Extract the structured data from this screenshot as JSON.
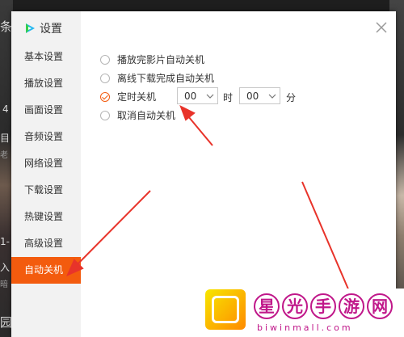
{
  "dialog": {
    "title": "设置",
    "close_icon": "close-icon",
    "accent_color": "#f35b0e"
  },
  "nav": [
    {
      "label": "基本设置",
      "active": false
    },
    {
      "label": "播放设置",
      "active": false
    },
    {
      "label": "画面设置",
      "active": false
    },
    {
      "label": "音频设置",
      "active": false
    },
    {
      "label": "网络设置",
      "active": false
    },
    {
      "label": "下载设置",
      "active": false
    },
    {
      "label": "热键设置",
      "active": false
    },
    {
      "label": "高级设置",
      "active": false
    },
    {
      "label": "自动关机",
      "active": true
    }
  ],
  "options": [
    {
      "label": "播放完影片自动关机",
      "selected": false
    },
    {
      "label": "离线下载完成自动关机",
      "selected": false
    },
    {
      "label": "定时关机",
      "selected": true
    },
    {
      "label": "取消自动关机",
      "selected": false
    }
  ],
  "timer": {
    "hour_value": "00",
    "hour_unit": "时",
    "minute_value": "00",
    "minute_unit": "分"
  },
  "background": {
    "left_texts": [
      "条",
      "4",
      "目",
      "老",
      "1-",
      "入",
      "暗",
      "园"
    ]
  },
  "watermark": {
    "chars": [
      "星",
      "光",
      "手",
      "游",
      "网"
    ],
    "domain": "biwinmall.com"
  }
}
